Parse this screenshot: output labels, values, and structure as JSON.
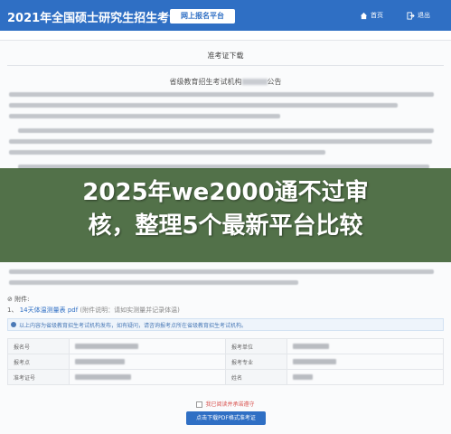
{
  "header": {
    "site_title": "2021年全国硕士研究生招生考试",
    "platform_label": "网上报名平台",
    "nav": [
      {
        "label": "首页",
        "icon": "home-icon"
      },
      {
        "label": "退出",
        "icon": "exit-icon"
      }
    ]
  },
  "section": {
    "title": "准考证下载",
    "notice_title": "省级教育招生考试机构",
    "notice_title_suffix": "公告"
  },
  "overlay": {
    "headline_line1": "2025年we2000通不过审",
    "headline_line2": "核，整理5个最新平台比较"
  },
  "attachments": {
    "label": "附件:",
    "items": [
      {
        "index": "1、",
        "link": "14天体温测量表 pdf",
        "note": "(附件说明：请如实测量并记录体温)"
      }
    ]
  },
  "info_bar": {
    "text": "以上内容为省级教育招生考试机构发布，如有疑问，请咨询报考点所在省级教育招生考试机构。"
  },
  "info_table": {
    "rows": [
      [
        "报名号",
        "报考单位"
      ],
      [
        "报考点",
        "报考专业"
      ],
      [
        "准考证号",
        "姓名"
      ]
    ]
  },
  "agreement": {
    "text": "我已阅读并承诺遵守"
  },
  "download": {
    "label": "点击下载PDF格式准考证"
  },
  "colors": {
    "brand_blue": "#2f6fc4",
    "overlay_green": "#224a16"
  }
}
